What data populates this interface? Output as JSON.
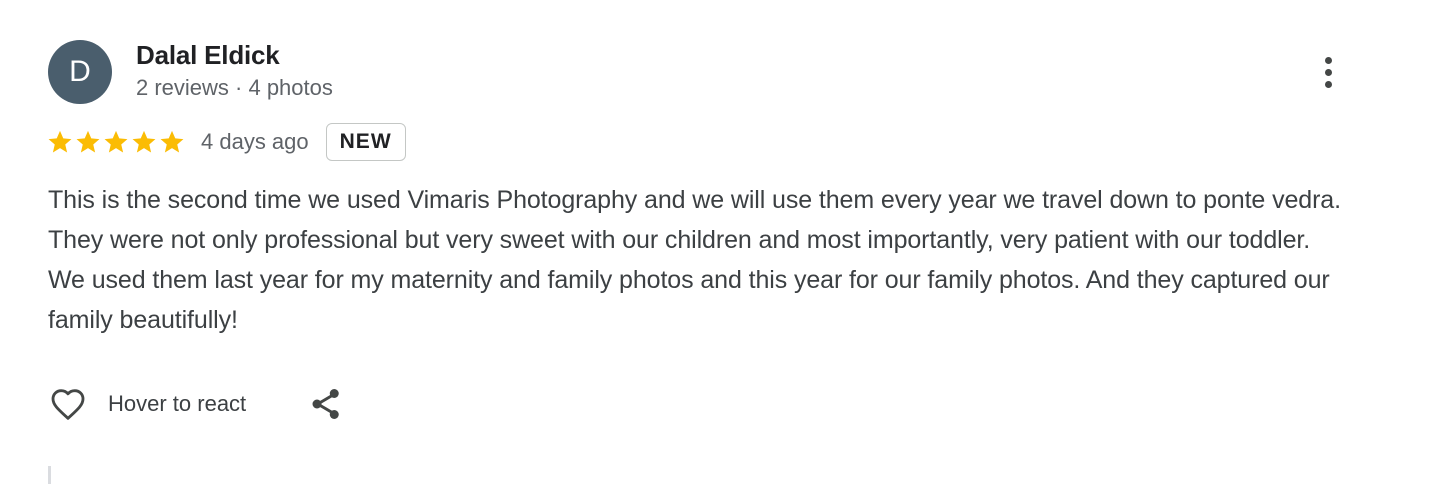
{
  "review": {
    "author": {
      "initial": "D",
      "name": "Dalal Eldick",
      "meta": "2 reviews · 4 photos",
      "avatar_color": "#4a5e6d"
    },
    "rating": {
      "stars": 5,
      "max_stars": 5,
      "star_color": "#fbbc04"
    },
    "date": "4 days ago",
    "badge": "NEW",
    "text": "This is the second time we used Vimaris Photography and we will use them every year we travel down to ponte vedra. They were not only professional but very sweet with our children and most importantly, very patient with our toddler. We used them last year for my maternity and family photos and this year for our family photos. And they captured our family beautifully!",
    "actions": {
      "react_label": "Hover to react",
      "react_icon": "heart-outline-icon",
      "share_icon": "share-icon",
      "more_icon": "more-vertical-icon"
    }
  }
}
